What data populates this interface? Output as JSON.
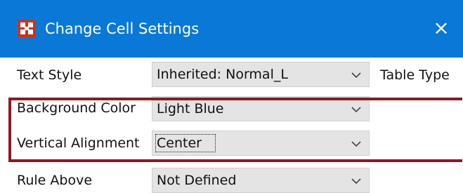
{
  "dialog": {
    "title": "Change Cell Settings",
    "close_glyph": "×",
    "app_icon": "app-logo-icon",
    "title_bar_color": "#0a78d6",
    "highlight_color": "#8c1a24"
  },
  "fields": {
    "text_style": {
      "label": "Text Style",
      "value": "Inherited: Normal_L"
    },
    "background_color": {
      "label": "Background Color",
      "value": "Light Blue"
    },
    "vertical_alignment": {
      "label": "Vertical Alignment",
      "value": "Center"
    },
    "rule_above": {
      "label": "Rule Above",
      "value": "Not Defined"
    }
  },
  "side": {
    "table_type_label": "Table Type"
  }
}
